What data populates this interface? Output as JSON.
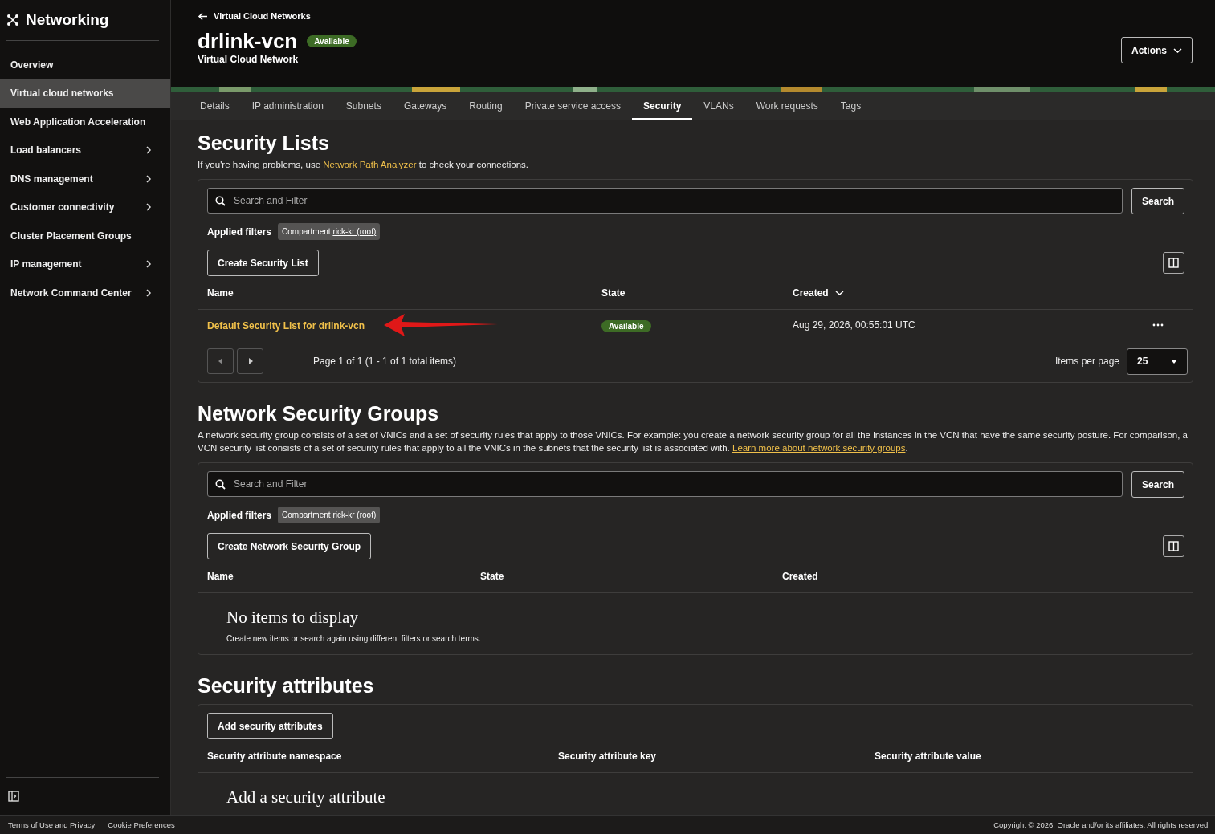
{
  "sidebar": {
    "title": "Networking",
    "items": [
      {
        "label": "Overview",
        "selected": false,
        "expandable": false
      },
      {
        "label": "Virtual cloud networks",
        "selected": true,
        "expandable": false
      },
      {
        "label": "Web Application Acceleration",
        "selected": false,
        "expandable": false
      },
      {
        "label": "Load balancers",
        "selected": false,
        "expandable": true
      },
      {
        "label": "DNS management",
        "selected": false,
        "expandable": true
      },
      {
        "label": "Customer connectivity",
        "selected": false,
        "expandable": true
      },
      {
        "label": "Cluster Placement Groups",
        "selected": false,
        "expandable": false
      },
      {
        "label": "IP management",
        "selected": false,
        "expandable": true
      },
      {
        "label": "Network Command Center",
        "selected": false,
        "expandable": true
      }
    ]
  },
  "header": {
    "back_link": "Virtual Cloud Networks",
    "title": "drlink-vcn",
    "status": "Available",
    "subtitle": "Virtual Cloud Network",
    "actions": "Actions"
  },
  "tabs": [
    {
      "label": "Details",
      "selected": false
    },
    {
      "label": "IP administration",
      "selected": false
    },
    {
      "label": "Subnets",
      "selected": false
    },
    {
      "label": "Gateways",
      "selected": false
    },
    {
      "label": "Routing",
      "selected": false
    },
    {
      "label": "Private service access",
      "selected": false
    },
    {
      "label": "Security",
      "selected": true
    },
    {
      "label": "VLANs",
      "selected": false
    },
    {
      "label": "Work requests",
      "selected": false
    },
    {
      "label": "Tags",
      "selected": false
    }
  ],
  "security_lists": {
    "heading": "Security Lists",
    "intro_before": "If you're having problems, use",
    "intro_link": "Network Path Analyzer",
    "intro_after": "to check your connections.",
    "filter": {
      "placeholder": "Search and Filter",
      "search_button": "Search",
      "applied_label": "Applied filters",
      "chip_label": "Compartment",
      "chip_value": "rick-kr (root)"
    },
    "create_button": "Create Security List",
    "columns": [
      {
        "label": "Name",
        "sortable": false
      },
      {
        "label": "State",
        "sortable": false
      },
      {
        "label": "Created",
        "sortable": true
      }
    ],
    "rows": [
      {
        "name": "Default Security List for drlink-vcn",
        "state": "Available",
        "created": "Aug 29, 2026, 00:55:01 UTC"
      }
    ],
    "pagination": {
      "text": "Page 1 of 1 (1 - 1 of 1 total items)",
      "per_page_label": "Items per page",
      "page_size": "25"
    }
  },
  "network_security_groups": {
    "heading": "Network Security Groups",
    "description": "A network security group consists of a set of VNICs and a set of security rules that apply to those VNICs. For example: you create a network security group for all the instances in the VCN that have the same security posture. For comparison, a VCN security list consists of a set of security rules that apply to all the VNICs in the subnets that the security list is associated with.",
    "link": "Learn more about network security groups",
    "link_after": ".",
    "filter": {
      "placeholder": "Search and Filter",
      "search_button": "Search",
      "applied_label": "Applied filters",
      "chip_label": "Compartment",
      "chip_value": "rick-kr (root)"
    },
    "create_button": "Create Network Security Group",
    "columns": [
      {
        "label": "Name"
      },
      {
        "label": "State"
      },
      {
        "label": "Created"
      }
    ],
    "empty_title": "No items to display",
    "empty_text": "Create new items or search again using different filters or search terms."
  },
  "security_attributes": {
    "heading": "Security attributes",
    "add_button": "Add security attributes",
    "columns": [
      {
        "label": "Security attribute namespace"
      },
      {
        "label": "Security attribute key"
      },
      {
        "label": "Security attribute value"
      }
    ],
    "empty_title": "Add a security attribute"
  },
  "footer": {
    "links": [
      "Terms of Use and Privacy",
      "Cookie Preferences"
    ],
    "copyright": "Copyright © 2026, Oracle and/or its affiliates. All rights reserved."
  }
}
